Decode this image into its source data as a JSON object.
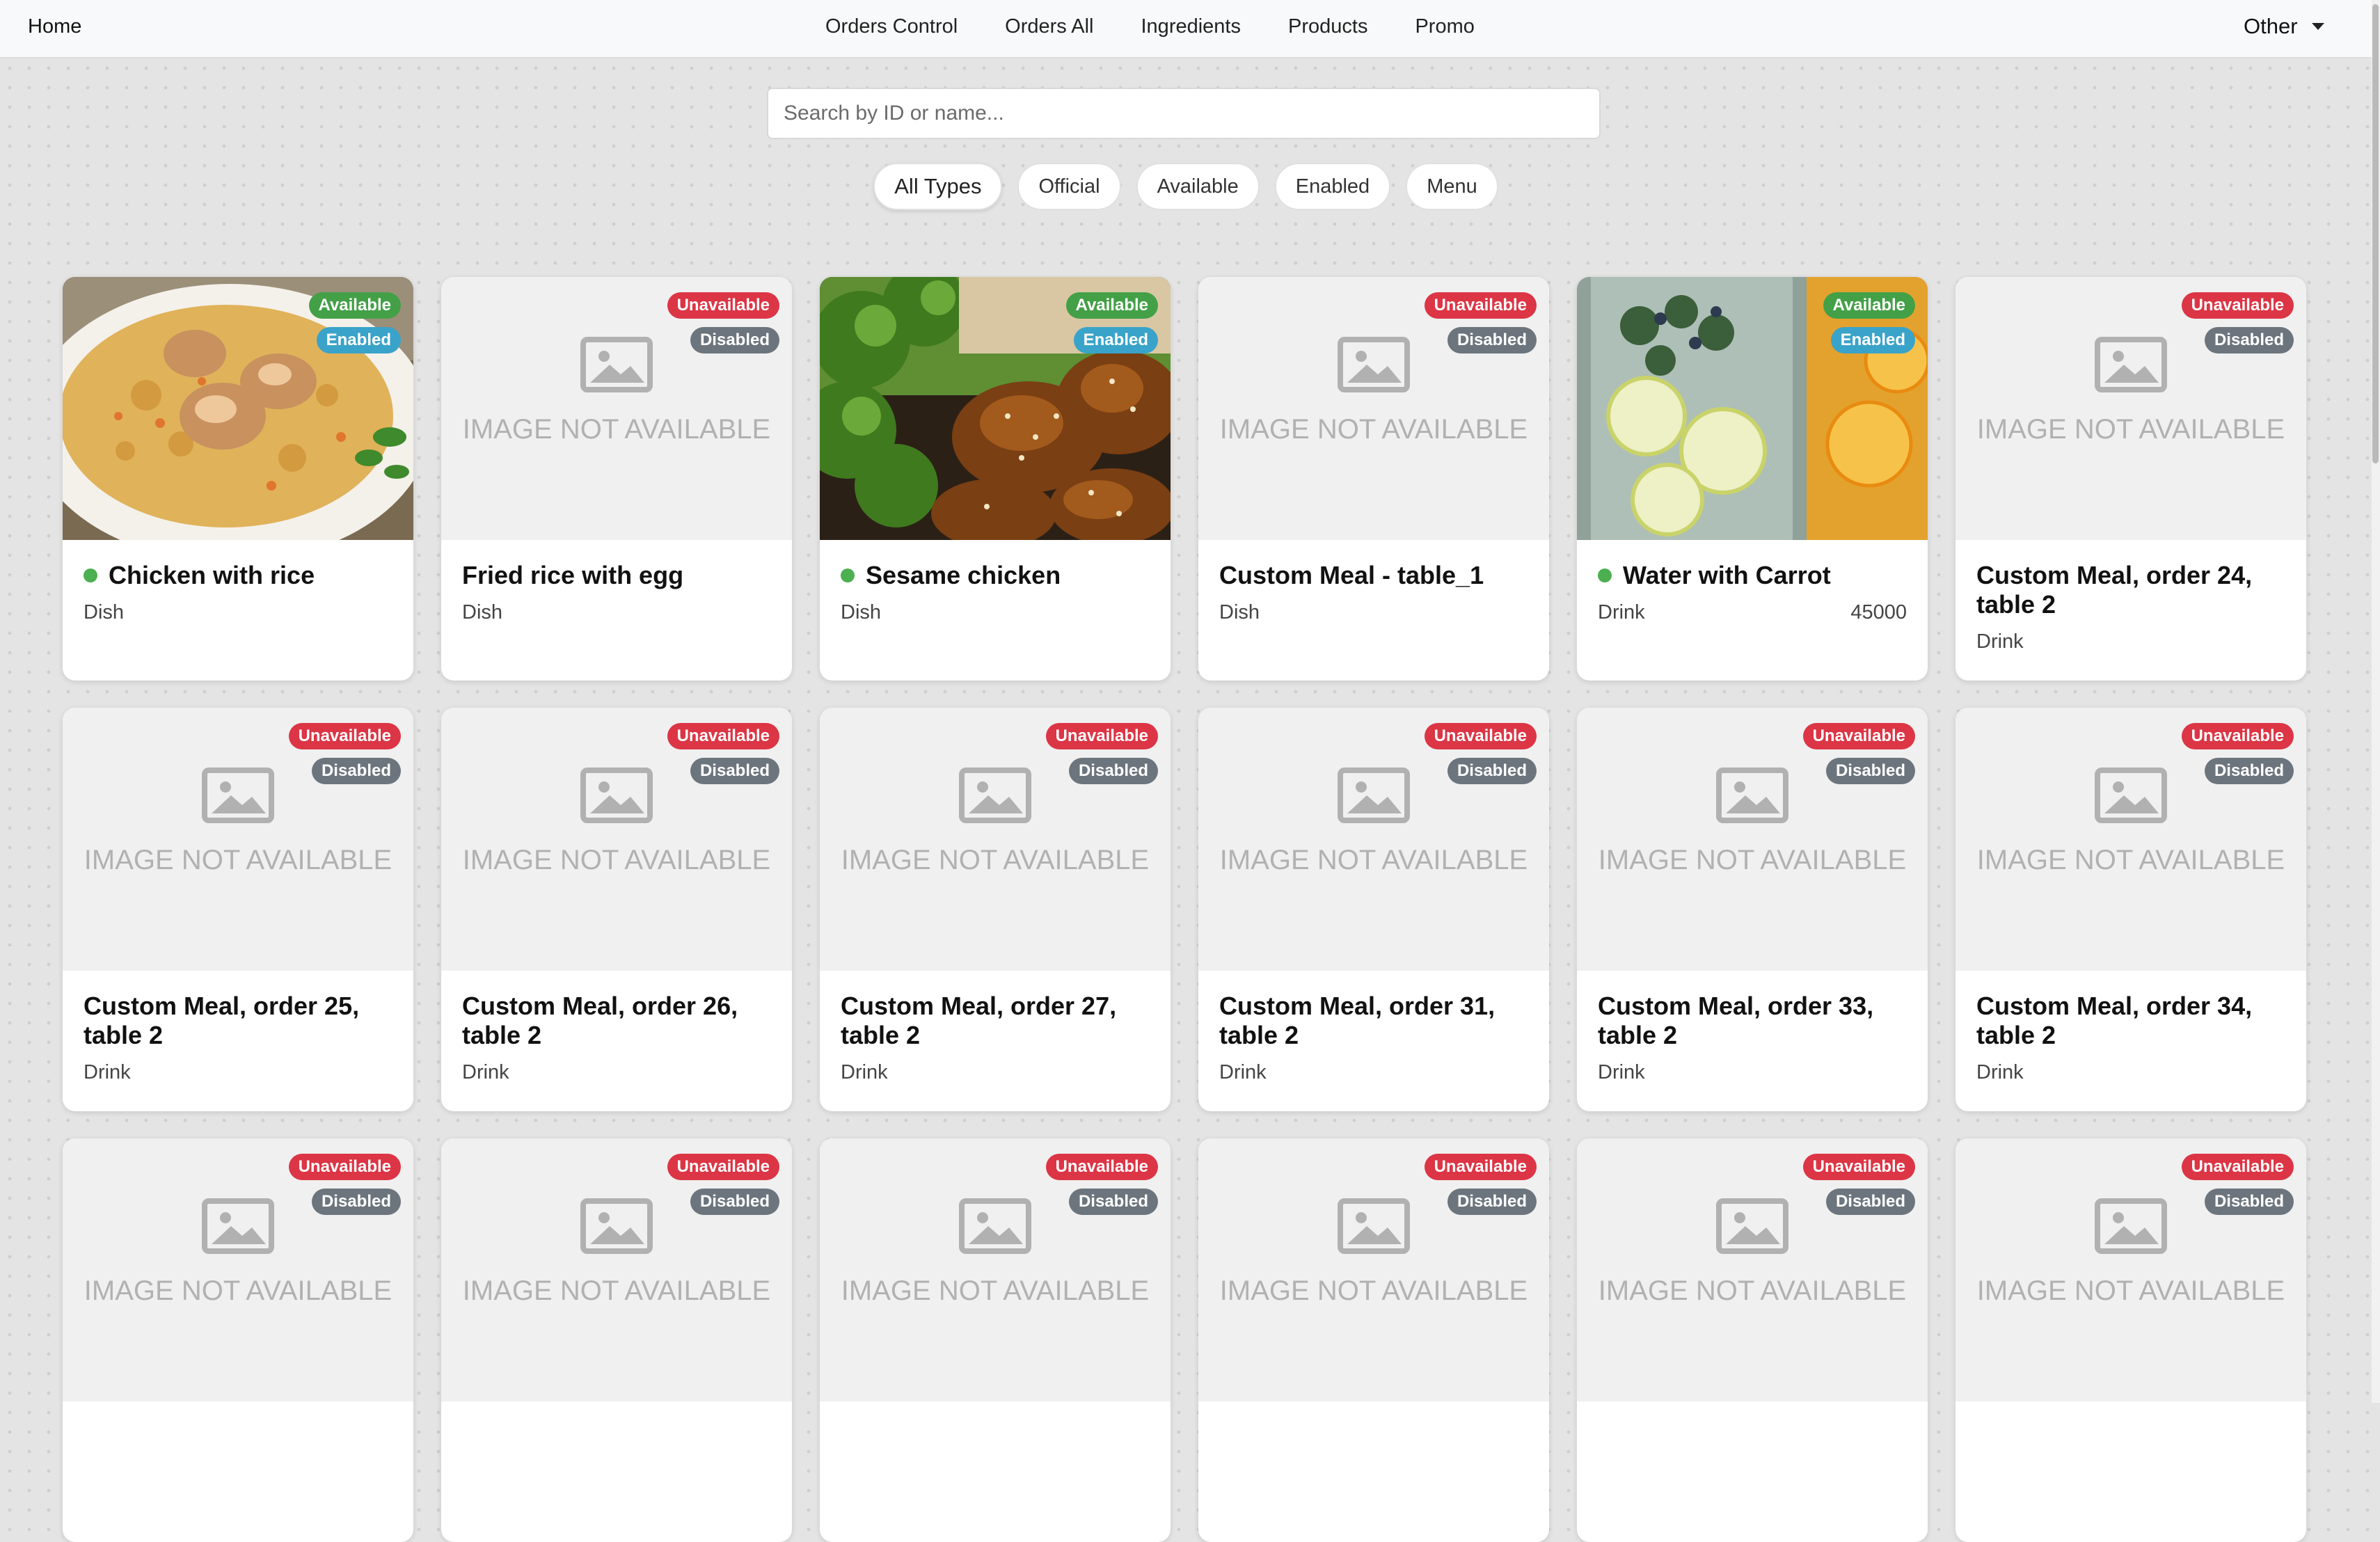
{
  "nav": {
    "home": "Home",
    "links": [
      "Orders Control",
      "Orders All",
      "Ingredients",
      "Products",
      "Promo"
    ],
    "other": "Other"
  },
  "search": {
    "placeholder": "Search by ID or name..."
  },
  "filters": [
    "All Types",
    "Official",
    "Available",
    "Enabled",
    "Menu"
  ],
  "image_placeholder": "IMAGE NOT AVAILABLE",
  "colors": {
    "available": "#43a047",
    "unavailable": "#dc3545",
    "enabled": "#3aa3c9",
    "disabled": "#6c757d",
    "active_dot": "#4caf50"
  },
  "products": [
    {
      "name": "Chicken with rice",
      "type": "Dish",
      "price": "",
      "availability": "Available",
      "status": "Enabled",
      "image": "chicken-rice-photo",
      "active": true
    },
    {
      "name": "Fried rice with egg",
      "type": "Dish",
      "price": "",
      "availability": "Unavailable",
      "status": "Disabled",
      "image": "",
      "active": false
    },
    {
      "name": "Sesame chicken",
      "type": "Dish",
      "price": "",
      "availability": "Available",
      "status": "Enabled",
      "image": "sesame-chicken-photo",
      "active": true
    },
    {
      "name": "Custom Meal - table_1",
      "type": "Dish",
      "price": "",
      "availability": "Unavailable",
      "status": "Disabled",
      "image": "",
      "active": false
    },
    {
      "name": "Water with Carrot",
      "type": "Drink",
      "price": "45000",
      "availability": "Available",
      "status": "Enabled",
      "image": "lemon-water-photo",
      "active": true
    },
    {
      "name": "Custom Meal, order 24, table 2",
      "type": "Drink",
      "price": "",
      "availability": "Unavailable",
      "status": "Disabled",
      "image": "",
      "active": false
    },
    {
      "name": "Custom Meal, order 25, table 2",
      "type": "Drink",
      "price": "",
      "availability": "Unavailable",
      "status": "Disabled",
      "image": "",
      "active": false
    },
    {
      "name": "Custom Meal, order 26, table 2",
      "type": "Drink",
      "price": "",
      "availability": "Unavailable",
      "status": "Disabled",
      "image": "",
      "active": false
    },
    {
      "name": "Custom Meal, order 27, table 2",
      "type": "Drink",
      "price": "",
      "availability": "Unavailable",
      "status": "Disabled",
      "image": "",
      "active": false
    },
    {
      "name": "Custom Meal, order 31, table 2",
      "type": "Drink",
      "price": "",
      "availability": "Unavailable",
      "status": "Disabled",
      "image": "",
      "active": false
    },
    {
      "name": "Custom Meal, order 33, table 2",
      "type": "Drink",
      "price": "",
      "availability": "Unavailable",
      "status": "Disabled",
      "image": "",
      "active": false
    },
    {
      "name": "Custom Meal, order 34, table 2",
      "type": "Drink",
      "price": "",
      "availability": "Unavailable",
      "status": "Disabled",
      "image": "",
      "active": false
    },
    {
      "name": "",
      "type": "",
      "price": "",
      "availability": "Unavailable",
      "status": "Disabled",
      "image": "",
      "active": false
    },
    {
      "name": "",
      "type": "",
      "price": "",
      "availability": "Unavailable",
      "status": "Disabled",
      "image": "",
      "active": false
    },
    {
      "name": "",
      "type": "",
      "price": "",
      "availability": "Unavailable",
      "status": "Disabled",
      "image": "",
      "active": false
    },
    {
      "name": "",
      "type": "",
      "price": "",
      "availability": "Unavailable",
      "status": "Disabled",
      "image": "",
      "active": false
    },
    {
      "name": "",
      "type": "",
      "price": "",
      "availability": "Unavailable",
      "status": "Disabled",
      "image": "",
      "active": false
    },
    {
      "name": "",
      "type": "",
      "price": "",
      "availability": "Unavailable",
      "status": "Disabled",
      "image": "",
      "active": false
    }
  ]
}
